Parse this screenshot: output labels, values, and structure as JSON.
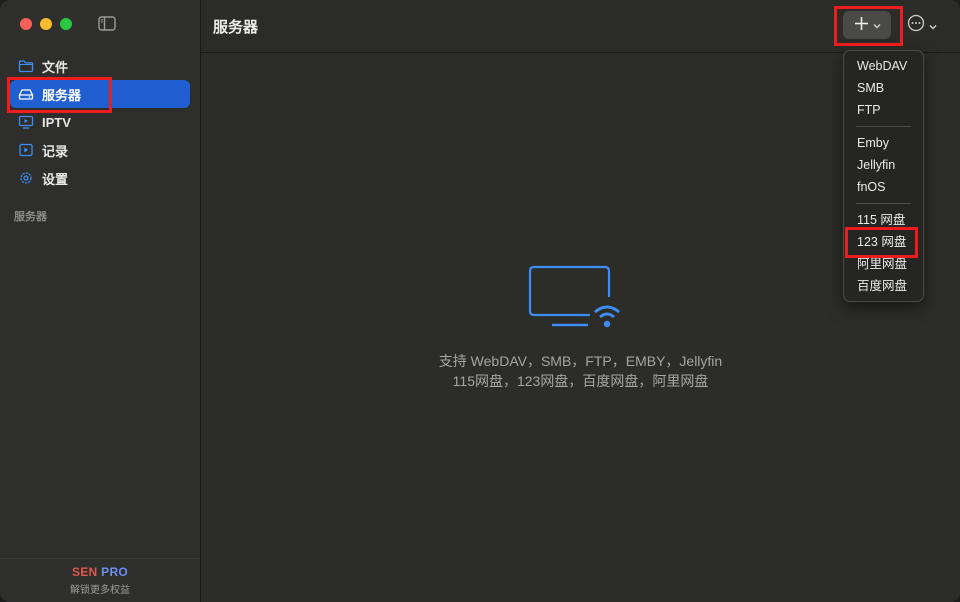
{
  "sidebar": {
    "items": [
      {
        "label": "文件",
        "icon": "folder-icon"
      },
      {
        "label": "服务器",
        "icon": "server-drive-icon"
      },
      {
        "label": "IPTV",
        "icon": "tv-icon"
      },
      {
        "label": "记录",
        "icon": "play-record-icon"
      },
      {
        "label": "设置",
        "icon": "gear-icon"
      }
    ],
    "section_title": "服务器",
    "promo": {
      "brand_sen": "SEN",
      "brand_pro": "PRO",
      "subtitle": "解锁更多权益"
    }
  },
  "toolbar": {
    "title": "服务器",
    "add_icon": "plus-icon",
    "more_icon": "ellipsis-circle-icon"
  },
  "main": {
    "empty_icon": "tv-wifi-icon",
    "empty_line1": "支持 WebDAV，SMB，FTP，EMBY，Jellyfin",
    "empty_line2": "115网盘，123网盘，百度网盘，阿里网盘"
  },
  "menu": {
    "groups": [
      [
        "WebDAV",
        "SMB",
        "FTP"
      ],
      [
        "Emby",
        "Jellyfin",
        "fnOS"
      ],
      [
        "115 网盘",
        "123 网盘",
        "阿里网盘",
        "百度网盘"
      ]
    ]
  },
  "colors": {
    "accent": "#1f5fd1",
    "highlight": "#ee1c1c",
    "icon_blue": "#3d8df5"
  }
}
